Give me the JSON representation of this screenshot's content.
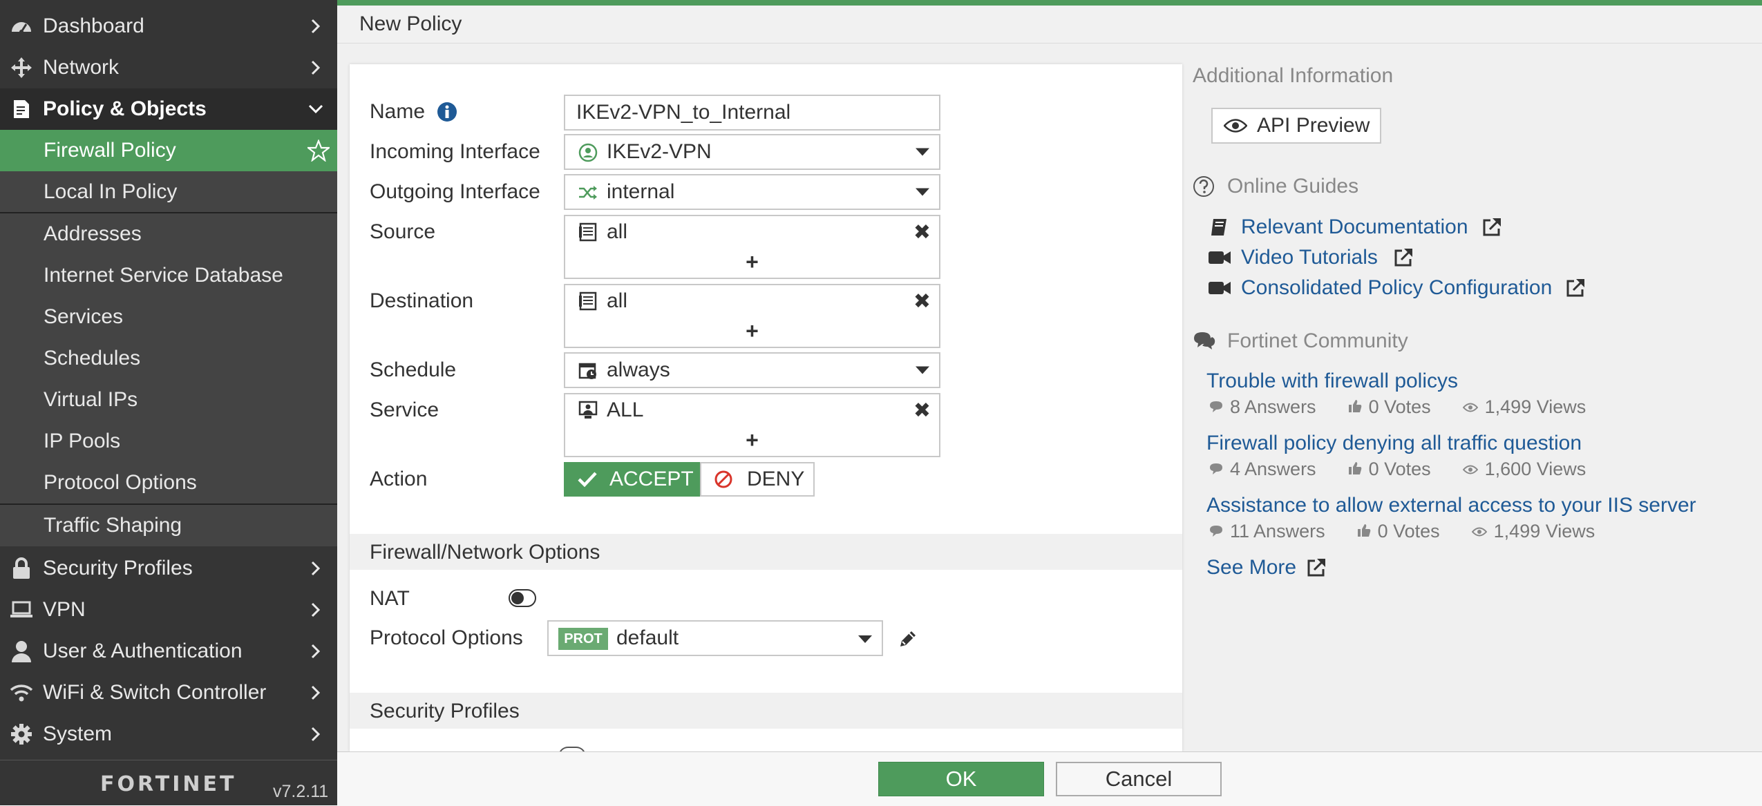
{
  "sidebar": {
    "items": [
      {
        "label": "Dashboard",
        "icon": "dashboard-icon"
      },
      {
        "label": "Network",
        "icon": "network-icon"
      },
      {
        "label": "Policy & Objects",
        "icon": "policy-icon"
      },
      {
        "label": "Firewall Policy"
      },
      {
        "label": "Local In Policy"
      },
      {
        "label": "Addresses"
      },
      {
        "label": "Internet Service Database"
      },
      {
        "label": "Services"
      },
      {
        "label": "Schedules"
      },
      {
        "label": "Virtual IPs"
      },
      {
        "label": "IP Pools"
      },
      {
        "label": "Protocol Options"
      },
      {
        "label": "Traffic Shaping"
      },
      {
        "label": "Security Profiles",
        "icon": "lock-icon"
      },
      {
        "label": "VPN",
        "icon": "laptop-icon"
      },
      {
        "label": "User & Authentication",
        "icon": "user-icon"
      },
      {
        "label": "WiFi & Switch Controller",
        "icon": "wifi-icon"
      },
      {
        "label": "System",
        "icon": "gear-icon"
      }
    ],
    "brand": "FORTINET",
    "version": "v7.2.11"
  },
  "header": {
    "title": "New Policy"
  },
  "form": {
    "name_label": "Name",
    "name_value": "IKEv2-VPN_to_Internal",
    "incoming_label": "Incoming Interface",
    "incoming_value": "IKEv2-VPN",
    "outgoing_label": "Outgoing Interface",
    "outgoing_value": "internal",
    "source_label": "Source",
    "source_value": "all",
    "destination_label": "Destination",
    "destination_value": "all",
    "schedule_label": "Schedule",
    "schedule_value": "always",
    "service_label": "Service",
    "service_value": "ALL",
    "action_label": "Action",
    "accept_label": "ACCEPT",
    "deny_label": "DENY",
    "plus": "+",
    "remove": "✖"
  },
  "firewall_options": {
    "title": "Firewall/Network Options",
    "nat_label": "NAT",
    "protocol_label": "Protocol Options",
    "protocol_badge": "PROT",
    "protocol_value": "default"
  },
  "security_profiles": {
    "title": "Security Profiles"
  },
  "right": {
    "additional_title": "Additional Information",
    "api_preview": "API Preview",
    "online_guides_title": "Online Guides",
    "guides": [
      {
        "label": "Relevant Documentation",
        "icon": "book-icon"
      },
      {
        "label": "Video Tutorials",
        "icon": "video-icon"
      },
      {
        "label": "Consolidated Policy Configuration",
        "icon": "video-icon"
      }
    ],
    "community_title": "Fortinet Community",
    "posts": [
      {
        "title": "Trouble with firewall policys",
        "answers": "8  Answers",
        "votes": "0  Votes",
        "views": "1,499  Views"
      },
      {
        "title": "Firewall policy denying all traffic question",
        "answers": "4  Answers",
        "votes": "0  Votes",
        "views": "1,600  Views"
      },
      {
        "title": "Assistance to allow external access to your IIS server",
        "answers": "11  Answers",
        "votes": "0  Votes",
        "views": "1,499  Views"
      }
    ],
    "see_more": "See More"
  },
  "footer": {
    "ok": "OK",
    "cancel": "Cancel"
  },
  "colors": {
    "accent": "#4e9b5c",
    "sidebar": "#353535",
    "link": "#1f5a96",
    "deny": "#d9352b"
  }
}
